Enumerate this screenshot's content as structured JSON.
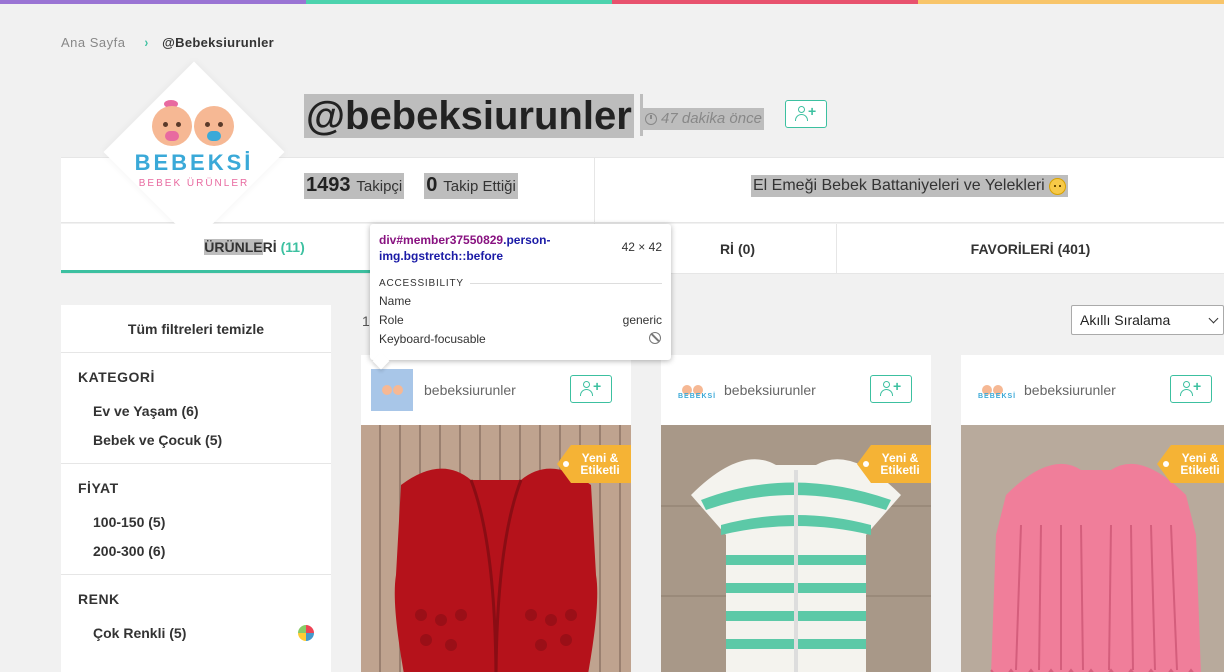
{
  "topbar_colors": [
    "#9a74d4",
    "#4dd3ae",
    "#e8526e",
    "#f8c56a"
  ],
  "breadcrumb": {
    "home": "Ana Sayfa",
    "separator": "›",
    "current": "@Bebeksiurunler"
  },
  "logo": {
    "title": "BEBEKSİ",
    "subtitle": "BEBEK ÜRÜNLER"
  },
  "profile": {
    "username": "@bebeksiurunler",
    "last_seen": "47 dakika önce",
    "followers_count": "1493",
    "followers_label": "Takipçi",
    "following_count": "0",
    "following_label": "Takip Ettiği",
    "bio": "El Emeği Bebek Battaniyeleri ve Yelekleri"
  },
  "tabs": [
    {
      "label_a": "ÜRÜNLE",
      "label_b": "Rİ",
      "count": "(11)"
    },
    {
      "label_a": "",
      "label_b": "Rİ",
      "count": "(0)"
    },
    {
      "label_a": "",
      "label_b": "FAVORİLERİ",
      "count": "(401)"
    }
  ],
  "filters": {
    "clear_label": "Tüm filtreleri temizle",
    "groups": [
      {
        "title": "KATEGORİ",
        "items": [
          "Ev ve Yaşam (6)",
          "Bebek ve Çocuk (5)"
        ]
      },
      {
        "title": "FİYAT",
        "items": [
          "100-150 (5)",
          "200-300 (6)"
        ]
      },
      {
        "title": "RENK",
        "items": [
          "Çok Renkli (5)"
        ]
      }
    ]
  },
  "results": {
    "count_prefix": "1"
  },
  "sort": {
    "selected": "Akıllı Sıralama"
  },
  "cards": [
    {
      "user": "bebeksiurunler",
      "badge_line1": "Yeni &",
      "badge_line2": "Etiketli",
      "color": "red"
    },
    {
      "user": "bebeksiurunler",
      "badge_line1": "Yeni &",
      "badge_line2": "Etiketli",
      "color": "mint-white-striped"
    },
    {
      "user": "bebeksiurunler",
      "badge_line1": "Yeni &",
      "badge_line2": "Etiketli",
      "color": "pink"
    }
  ],
  "tooltip": {
    "selector_tag": "div",
    "selector_id": "#member37550829",
    "selector_classes": ".person-img.bgstretch::before",
    "size": "42 × 42",
    "section": "ACCESSIBILITY",
    "rows": [
      {
        "label": "Name",
        "value": ""
      },
      {
        "label": "Role",
        "value": "generic"
      },
      {
        "label": "Keyboard-focusable",
        "value": ""
      }
    ]
  },
  "icons": {
    "clock": "clock-icon",
    "follow": "user-plus-icon",
    "chevron": "chevron-right-icon",
    "select": "chevron-down-icon",
    "not_focusable": "no-entry-icon",
    "emoji": "baby-face-emoji"
  }
}
